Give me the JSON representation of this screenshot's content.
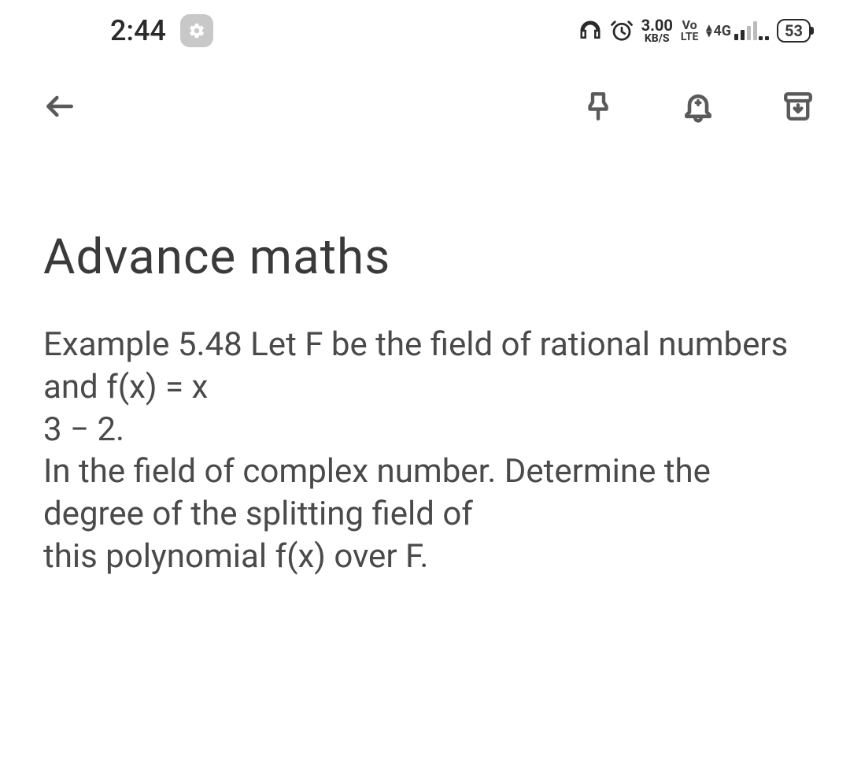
{
  "status_bar": {
    "time": "2:44",
    "net_speed_value": "3.00",
    "net_speed_unit": "KB/S",
    "volte_top": "Vo",
    "volte_bottom": "LTE",
    "signal_label": "4G",
    "battery_level": "53"
  },
  "toolbar": {
    "back_name": "back-icon",
    "pin_name": "pin-icon",
    "reminder_name": "reminder-icon",
    "archive_name": "archive-icon"
  },
  "note": {
    "title": "Advance  maths",
    "body": "Example 5.48 Let F be the field of rational numbers and f(x) = x\n3 − 2.\nIn the field of complex number. Determine the degree of the splitting field of\nthis polynomial f(x) over F."
  }
}
